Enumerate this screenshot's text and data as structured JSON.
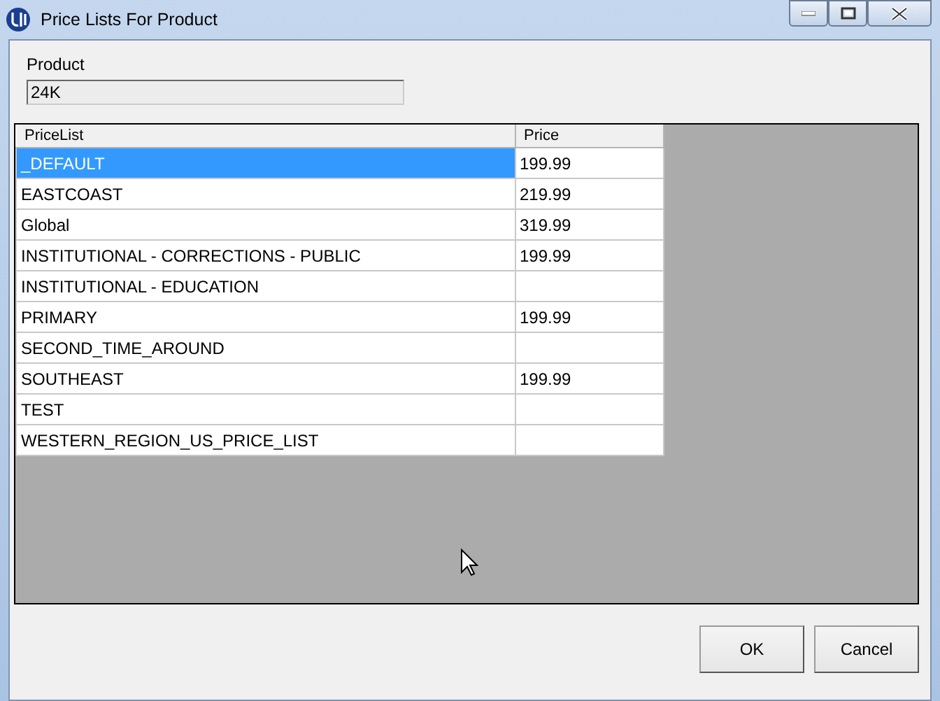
{
  "window": {
    "title": "Price Lists For Product"
  },
  "product": {
    "label": "Product",
    "value": "24K"
  },
  "table": {
    "columns": [
      "PriceList",
      "Price"
    ],
    "rows": [
      {
        "cells": [
          "_DEFAULT",
          "199.99"
        ],
        "selected": true
      },
      {
        "cells": [
          "EASTCOAST",
          "219.99"
        ],
        "selected": false
      },
      {
        "cells": [
          "Global",
          "319.99"
        ],
        "selected": false
      },
      {
        "cells": [
          "INSTITUTIONAL - CORRECTIONS - PUBLIC",
          "199.99"
        ],
        "selected": false
      },
      {
        "cells": [
          "INSTITUTIONAL - EDUCATION",
          ""
        ],
        "selected": false
      },
      {
        "cells": [
          "PRIMARY",
          "199.99"
        ],
        "selected": false
      },
      {
        "cells": [
          "SECOND_TIME_AROUND",
          ""
        ],
        "selected": false
      },
      {
        "cells": [
          "SOUTHEAST",
          "199.99"
        ],
        "selected": false
      },
      {
        "cells": [
          "TEST",
          ""
        ],
        "selected": false
      },
      {
        "cells": [
          "WESTERN_REGION_US_PRICE_LIST",
          ""
        ],
        "selected": false
      }
    ]
  },
  "buttons": [
    "OK",
    "Cancel"
  ]
}
